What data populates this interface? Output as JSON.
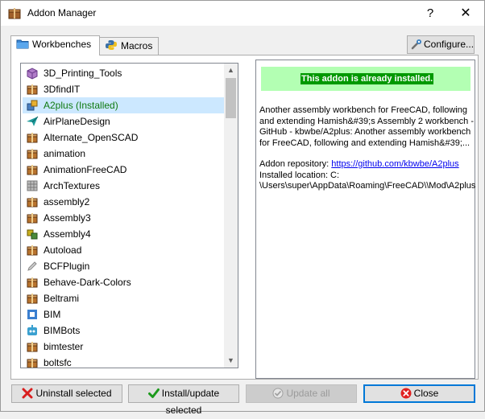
{
  "window": {
    "title": "Addon Manager",
    "help_glyph": "?",
    "close_glyph": "✕"
  },
  "tabs": [
    {
      "label": "Workbenches"
    },
    {
      "label": "Macros"
    }
  ],
  "configure_label": "Configure...",
  "addons": [
    {
      "label": "3D_Printing_Tools",
      "icon": "printer-cube-icon",
      "color": "#b07cc8"
    },
    {
      "label": "3DfindIT",
      "icon": "package-icon",
      "color": "#b8732d"
    },
    {
      "label": "A2plus (Installed)",
      "icon": "a2plus-icon",
      "color": "#4a7fc0",
      "installed": true,
      "selected": true
    },
    {
      "label": "AirPlaneDesign",
      "icon": "paper-plane-icon",
      "color": "#1f9b9b"
    },
    {
      "label": "Alternate_OpenSCAD",
      "icon": "package-icon",
      "color": "#b8732d"
    },
    {
      "label": "animation",
      "icon": "package-icon",
      "color": "#b8732d"
    },
    {
      "label": "AnimationFreeCAD",
      "icon": "package-icon",
      "color": "#b8732d"
    },
    {
      "label": "ArchTextures",
      "icon": "textures-icon",
      "color": "#7a7a7a"
    },
    {
      "label": "assembly2",
      "icon": "package-icon",
      "color": "#b8732d"
    },
    {
      "label": "Assembly3",
      "icon": "package-icon",
      "color": "#b8732d"
    },
    {
      "label": "Assembly4",
      "icon": "assembly4-icon",
      "color": "#c8b020"
    },
    {
      "label": "Autoload",
      "icon": "package-icon",
      "color": "#b8732d"
    },
    {
      "label": "BCFPlugin",
      "icon": "pencil-icon",
      "color": "#888888"
    },
    {
      "label": "Behave-Dark-Colors",
      "icon": "package-icon",
      "color": "#b8732d"
    },
    {
      "label": "Beltrami",
      "icon": "package-icon",
      "color": "#b8732d"
    },
    {
      "label": "BIM",
      "icon": "bim-icon",
      "color": "#3a7fd0"
    },
    {
      "label": "BIMBots",
      "icon": "bimbots-icon",
      "color": "#3aa0d0"
    },
    {
      "label": "bimtester",
      "icon": "package-icon",
      "color": "#b8732d"
    },
    {
      "label": "boltsfc",
      "icon": "package-icon",
      "color": "#b8732d"
    }
  ],
  "details": {
    "status": "This addon is already installed.",
    "description": "Another assembly workbench for FreeCAD, following and extending Hamish&#39;s Assembly 2 workbench - GitHub - kbwbe/A2plus: Another assembly workbench for FreeCAD, following and extending Hamish&#39;...",
    "repo_label": "Addon repository: ",
    "repo_url": "https://github.com/kbwbe/A2plus",
    "location_label": "Installed location: C:",
    "location_path": "\\Users\\super\\AppData\\Roaming\\FreeCAD\\\\Mod\\A2plus"
  },
  "buttons": {
    "uninstall": "Uninstall selected",
    "install": "Install/update selected",
    "update_all": "Update all",
    "close": "Close"
  },
  "colors": {
    "selection": "#cce8ff",
    "installed_text": "#0f7a0f",
    "status_bg": "#b3ffb3",
    "status_text_bg": "#009900"
  }
}
